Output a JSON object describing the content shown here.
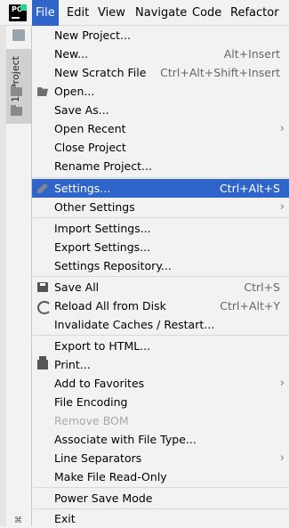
{
  "menubar": {
    "logo_text": "PC",
    "items": [
      {
        "label": "File",
        "active": true
      },
      {
        "label": "Edit"
      },
      {
        "label": "View"
      },
      {
        "label": "Navigate"
      },
      {
        "label": "Code"
      },
      {
        "label": "Refactor"
      }
    ]
  },
  "tool_window": {
    "project_tab_label": "1: Project"
  },
  "file_menu": {
    "items": [
      {
        "label": "New Project...",
        "shortcut": ""
      },
      {
        "label": "New...",
        "shortcut": "Alt+Insert"
      },
      {
        "label": "New Scratch File",
        "shortcut": "Ctrl+Alt+Shift+Insert"
      },
      {
        "label": "Open...",
        "icon": "folder-open-icon"
      },
      {
        "label": "Save As..."
      },
      {
        "label": "Open Recent",
        "submenu": true
      },
      {
        "label": "Close Project"
      },
      {
        "label": "Rename Project..."
      },
      {
        "label": "Settings...",
        "shortcut": "Ctrl+Alt+S",
        "icon": "wrench-icon",
        "selected": true
      },
      {
        "label": "Other Settings",
        "submenu": true
      },
      {
        "label": "Import Settings..."
      },
      {
        "label": "Export Settings..."
      },
      {
        "label": "Settings Repository..."
      },
      {
        "label": "Save All",
        "shortcut": "Ctrl+S",
        "icon": "save-icon"
      },
      {
        "label": "Reload All from Disk",
        "shortcut": "Ctrl+Alt+Y",
        "icon": "reload-icon"
      },
      {
        "label": "Invalidate Caches / Restart..."
      },
      {
        "label": "Export to HTML..."
      },
      {
        "label": "Print...",
        "icon": "print-icon"
      },
      {
        "label": "Add to Favorites",
        "submenu": true
      },
      {
        "label": "File Encoding"
      },
      {
        "label": "Remove BOM",
        "disabled": true
      },
      {
        "label": "Associate with File Type..."
      },
      {
        "label": "Line Separators",
        "submenu": true
      },
      {
        "label": "Make File Read-Only"
      },
      {
        "label": "Power Save Mode"
      },
      {
        "label": "Exit"
      }
    ],
    "submenu_arrow": "›"
  },
  "colors": {
    "selection": "#2f65ca",
    "background": "#f2f2f2",
    "disabled_text": "#a8a8a8"
  }
}
